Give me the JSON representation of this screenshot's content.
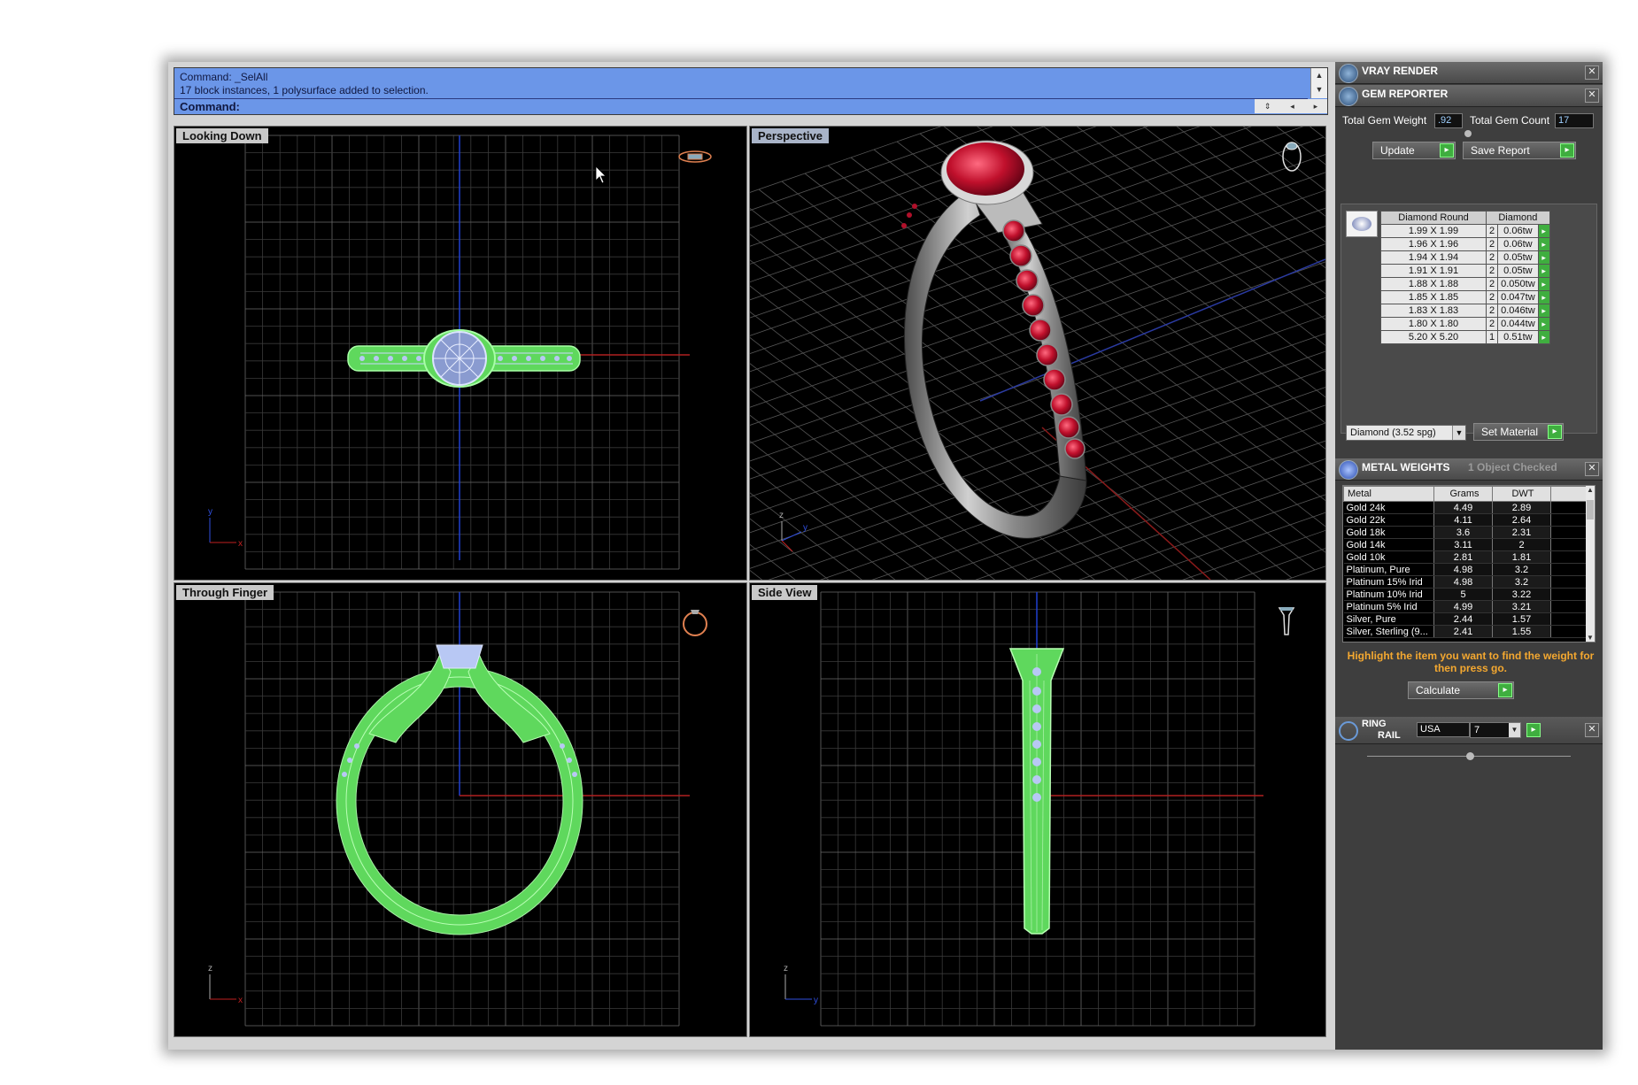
{
  "command": {
    "history": [
      "Command: _SelAll",
      "17 block instances, 1 polysurface added to selection."
    ],
    "prompt": "Command:"
  },
  "viewports": {
    "top_left": "Looking Down",
    "top_right": "Perspective",
    "bottom_left": "Through Finger",
    "bottom_right": "Side View"
  },
  "panels": {
    "vray": {
      "title": "VRAY RENDER"
    },
    "gem": {
      "title": "GEM REPORTER",
      "total_weight_label": "Total Gem Weight",
      "total_weight": ".92",
      "total_count_label": "Total Gem Count",
      "total_count": "17",
      "update_label": "Update",
      "save_label": "Save Report",
      "headers": [
        "Diamond Round",
        "Diamond"
      ],
      "rows": [
        {
          "size": "1.99 X 1.99",
          "qty": "2",
          "wt": "0.06tw"
        },
        {
          "size": "1.96 X 1.96",
          "qty": "2",
          "wt": "0.06tw"
        },
        {
          "size": "1.94 X 1.94",
          "qty": "2",
          "wt": "0.05tw"
        },
        {
          "size": "1.91 X 1.91",
          "qty": "2",
          "wt": "0.05tw"
        },
        {
          "size": "1.88 X 1.88",
          "qty": "2",
          "wt": "0.050tw"
        },
        {
          "size": "1.85 X 1.85",
          "qty": "2",
          "wt": "0.047tw"
        },
        {
          "size": "1.83 X 1.83",
          "qty": "2",
          "wt": "0.046tw"
        },
        {
          "size": "1.80 X 1.80",
          "qty": "2",
          "wt": "0.044tw"
        },
        {
          "size": "5.20 X 5.20",
          "qty": "1",
          "wt": "0.51tw"
        }
      ],
      "material_select": "Diamond    (3.52 spg)",
      "set_material_label": "Set Material"
    },
    "metal": {
      "title": "METAL WEIGHTS",
      "subtitle": "1 Object Checked",
      "headers": [
        "Metal",
        "Grams",
        "DWT"
      ],
      "rows": [
        {
          "name": "Gold 24k",
          "grams": "4.49",
          "dwt": "2.89"
        },
        {
          "name": "Gold 22k",
          "grams": "4.11",
          "dwt": "2.64"
        },
        {
          "name": "Gold 18k",
          "grams": "3.6",
          "dwt": "2.31"
        },
        {
          "name": "Gold 14k",
          "grams": "3.11",
          "dwt": "2"
        },
        {
          "name": "Gold 10k",
          "grams": "2.81",
          "dwt": "1.81"
        },
        {
          "name": "Platinum, Pure",
          "grams": "4.98",
          "dwt": "3.2"
        },
        {
          "name": "Platinum 15% Irid",
          "grams": "4.98",
          "dwt": "3.2"
        },
        {
          "name": "Platinum 10% Irid",
          "grams": "5",
          "dwt": "3.22"
        },
        {
          "name": "Platinum 5% Irid",
          "grams": "4.99",
          "dwt": "3.21"
        },
        {
          "name": "Silver, Pure",
          "grams": "2.44",
          "dwt": "1.57"
        },
        {
          "name": "Silver, Sterling (9...",
          "grams": "2.41",
          "dwt": "1.55"
        }
      ],
      "hint": "Highlight the item you want to find the weight for then press go.",
      "calculate_label": "Calculate"
    },
    "ring_rail": {
      "title_line1": "RING",
      "title_line2": "RAIL",
      "country": "USA",
      "size": "7"
    }
  },
  "colors": {
    "command_bg": "#6b96e8",
    "wire_green": "#7cf07a",
    "gem_blue": "#b9c8f5",
    "ruby": "#b0102a",
    "panel_bg": "#3e3e3e",
    "hint_orange": "#f4a830"
  }
}
